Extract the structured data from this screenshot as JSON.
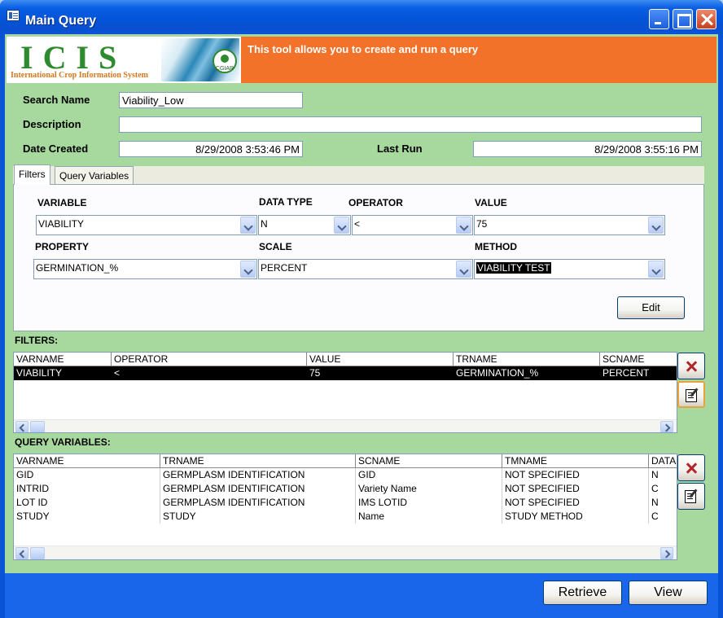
{
  "window": {
    "title": "Main Query"
  },
  "header": {
    "logo_text": "ICIS",
    "logo_subtitle": "International Crop Information System",
    "logo_seal": "CGIAR",
    "banner": "This tool allows you to create and run a query"
  },
  "fields": {
    "search_name_label": "Search Name",
    "search_name_value": "Viability_Low",
    "description_label": "Description",
    "description_value": "",
    "date_created_label": "Date Created",
    "date_created_value": "8/29/2008 3:53:46 PM",
    "last_run_label": "Last Run",
    "last_run_value": "8/29/2008 3:55:16 PM"
  },
  "tabs": [
    {
      "label": "Filters"
    },
    {
      "label": "Query Variables"
    }
  ],
  "filter_form": {
    "variable_header": "VARIABLE",
    "variable_value": "VIABILITY",
    "datatype_header": "DATA TYPE",
    "datatype_value": "N",
    "operator_header": "OPERATOR",
    "operator_value": "<",
    "value_header": "VALUE",
    "value_value": "75",
    "property_header": "PROPERTY",
    "property_value": "GERMINATION_%",
    "scale_header": "SCALE",
    "scale_value": "PERCENT",
    "method_header": "METHOD",
    "method_value": "VIABILITY TEST",
    "edit_label": "Edit"
  },
  "filters": {
    "title": "FILTERS:",
    "columns": [
      "VARNAME",
      "OPERATOR",
      "VALUE",
      "TRNAME",
      "SCNAME"
    ],
    "rows": [
      [
        "VIABILITY",
        "<",
        "75",
        "GERMINATION_%",
        "PERCENT"
      ]
    ]
  },
  "query_variables": {
    "title": "QUERY VARIABLES:",
    "columns": [
      "VARNAME",
      "TRNAME",
      "SCNAME",
      "TMNAME",
      "DATA"
    ],
    "rows": [
      [
        "GID",
        "GERMPLASM IDENTIFICATION",
        "GID",
        "NOT SPECIFIED",
        "N"
      ],
      [
        "INTRID",
        "GERMPLASM IDENTIFICATION",
        "Variety Name",
        "NOT SPECIFIED",
        "C"
      ],
      [
        "LOT ID",
        "GERMPLASM IDENTIFICATION",
        "IMS LOTID",
        "NOT SPECIFIED",
        "N"
      ],
      [
        "STUDY",
        "STUDY",
        "Name",
        "STUDY METHOD",
        "C"
      ]
    ]
  },
  "footer": {
    "retrieve_label": "Retrieve",
    "view_label": "View"
  }
}
